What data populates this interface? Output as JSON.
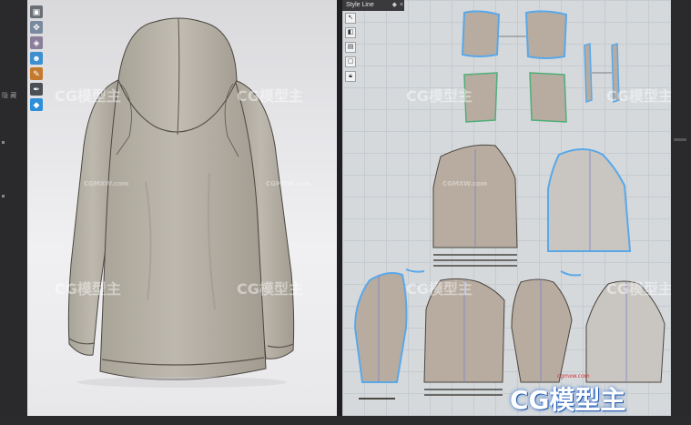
{
  "window": {
    "left_label": "隐 藏",
    "pattern_tab": "Style Line",
    "pattern_tab_icon": "pin-icon",
    "pattern_tab_close": "×"
  },
  "toolbar3d": {
    "tools": [
      "select-mesh-icon",
      "fold-arrangement-icon",
      "texture-edit-icon",
      "avatar-display-icon",
      "brush-icon",
      "pen-icon",
      "pin-icon"
    ]
  },
  "toolbar2d": {
    "tools": [
      "pointer-icon",
      "edit-point-icon",
      "select-outline-icon",
      "pattern-icon",
      "lock-icon"
    ]
  },
  "watermarks": {
    "brand": "CG模型主",
    "site": "CGMXW.com",
    "site_small": "cgmxw.com"
  },
  "colors": {
    "garment": "#b7b1a6",
    "pattern_fill": "#b8aca0",
    "selected_outline": "#5aa8e8",
    "green_outline": "#4fae7a",
    "pattern_bg": "#d5d9dc"
  }
}
